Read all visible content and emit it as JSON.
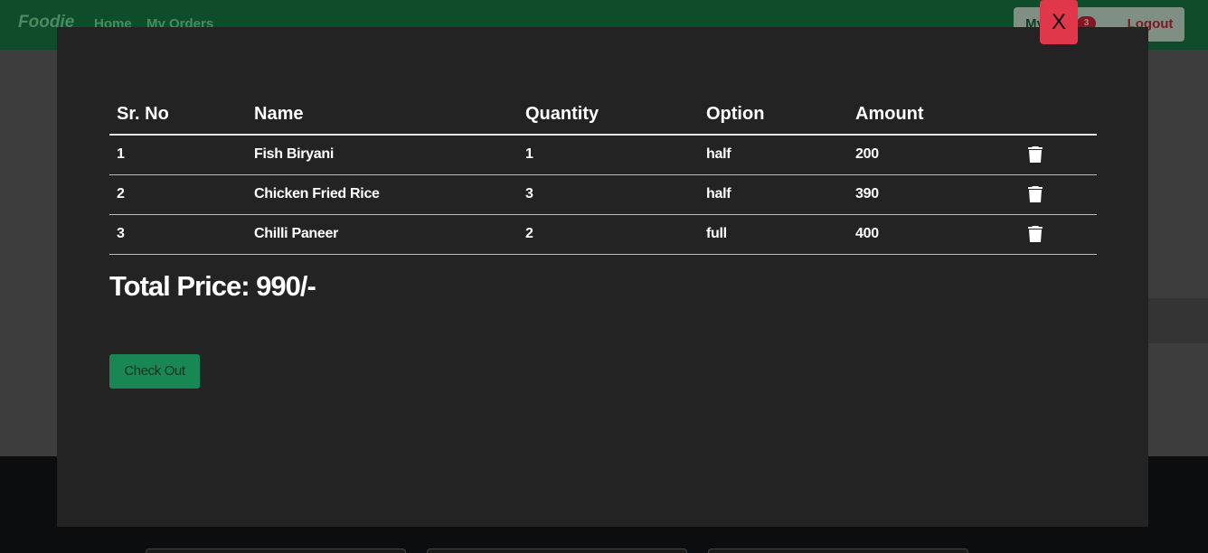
{
  "navbar": {
    "brand": "Foodie",
    "links": [
      "Home",
      "My Orders"
    ],
    "cart_label": "My Cart",
    "cart_count": "3",
    "logout_label": "Logout"
  },
  "modal": {
    "close_label": "X",
    "columns": [
      "Sr. No",
      "Name",
      "Quantity",
      "Option",
      "Amount"
    ],
    "rows": [
      {
        "sr": "1",
        "name": "Fish Biryani",
        "qty": "1",
        "option": "half",
        "amount": "200"
      },
      {
        "sr": "2",
        "name": "Chicken Fried Rice",
        "qty": "3",
        "option": "half",
        "amount": "390"
      },
      {
        "sr": "3",
        "name": "Chilli Paneer",
        "qty": "2",
        "option": "full",
        "amount": "400"
      }
    ],
    "total_label": "Total Price: 990/-",
    "checkout_label": "Check Out"
  }
}
